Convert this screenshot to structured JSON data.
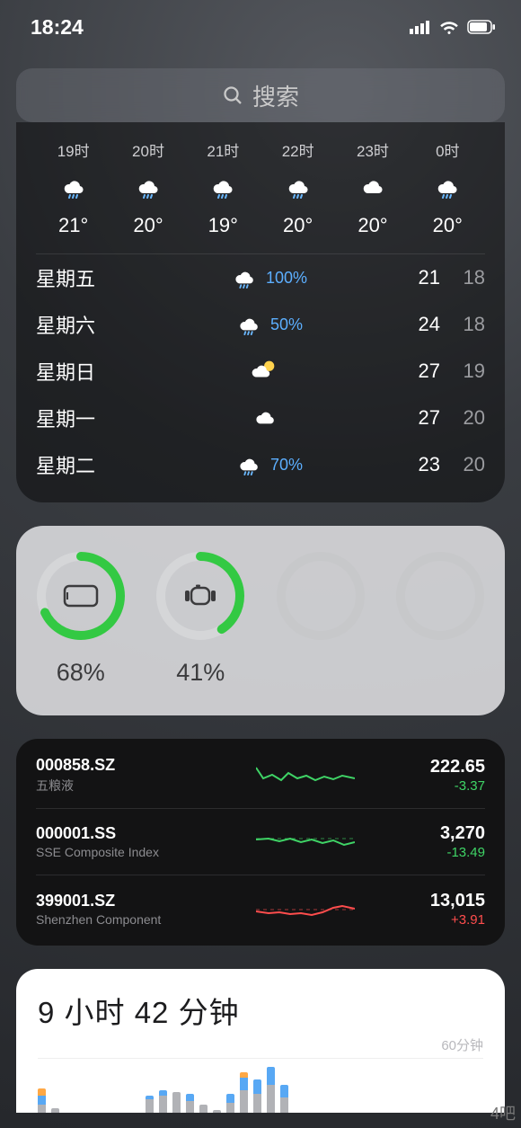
{
  "status": {
    "time": "18:24"
  },
  "search": {
    "placeholder": "搜索"
  },
  "weather": {
    "hourly": [
      {
        "label": "19时",
        "icon": "rain",
        "temp": "21°"
      },
      {
        "label": "20时",
        "icon": "rain",
        "temp": "20°"
      },
      {
        "label": "21时",
        "icon": "rain",
        "temp": "19°"
      },
      {
        "label": "22时",
        "icon": "rain",
        "temp": "20°"
      },
      {
        "label": "23时",
        "icon": "cloud",
        "temp": "20°"
      },
      {
        "label": "0时",
        "icon": "rain",
        "temp": "20°"
      }
    ],
    "daily": [
      {
        "day": "星期五",
        "icon": "rain",
        "pop": "100%",
        "hi": "21",
        "lo": "18"
      },
      {
        "day": "星期六",
        "icon": "rain",
        "pop": "50%",
        "hi": "24",
        "lo": "18"
      },
      {
        "day": "星期日",
        "icon": "partly",
        "pop": "",
        "hi": "27",
        "lo": "19"
      },
      {
        "day": "星期一",
        "icon": "cloud",
        "pop": "",
        "hi": "27",
        "lo": "20"
      },
      {
        "day": "星期二",
        "icon": "rain",
        "pop": "70%",
        "hi": "23",
        "lo": "20"
      }
    ]
  },
  "batteries": [
    {
      "device": "phone",
      "pct": 68,
      "label": "68%",
      "color": "#33c943"
    },
    {
      "device": "watch",
      "pct": 41,
      "label": "41%",
      "color": "#33c943"
    },
    {
      "device": "empty",
      "pct": 0,
      "label": "",
      "color": "#d5d6d8"
    },
    {
      "device": "empty",
      "pct": 0,
      "label": "",
      "color": "#d5d6d8"
    }
  ],
  "stocks": [
    {
      "symbol": "000858.SZ",
      "name": "五粮液",
      "price": "222.65",
      "change": "-3.37",
      "dir": "neg"
    },
    {
      "symbol": "000001.SS",
      "name": "SSE Composite Index",
      "price": "3,270",
      "change": "-13.49",
      "dir": "neg"
    },
    {
      "symbol": "399001.SZ",
      "name": "Shenzhen Component",
      "price": "13,015",
      "change": "+3.91",
      "dir": "pos"
    }
  ],
  "screentime": {
    "headline": "9 小时 42 分钟",
    "axis_label": "60分钟"
  },
  "watermark": "4吧"
}
